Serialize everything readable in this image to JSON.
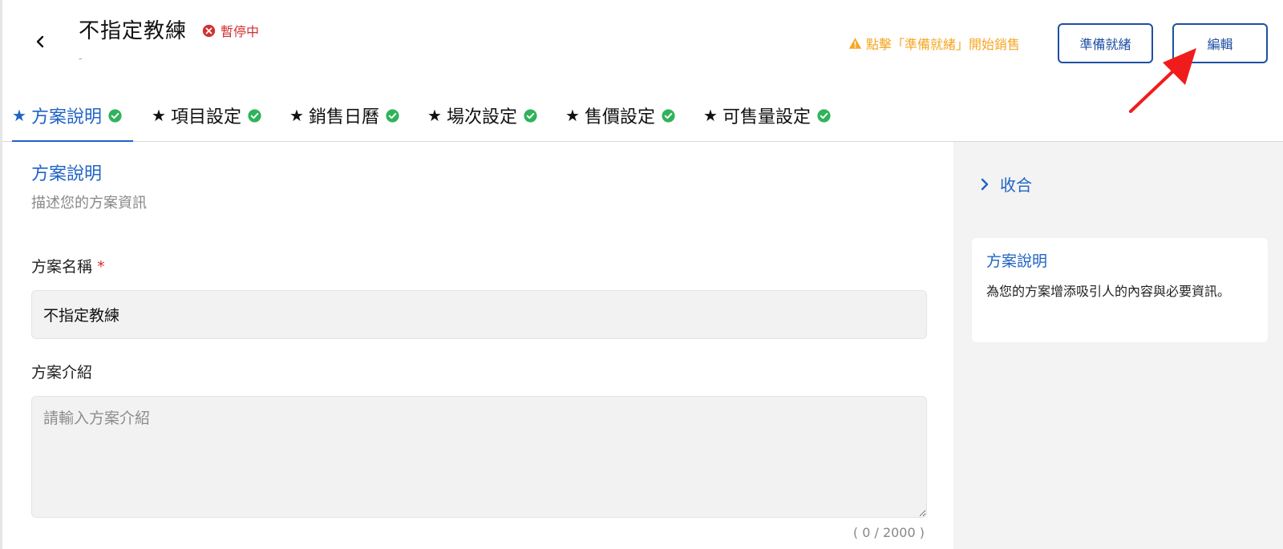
{
  "header": {
    "title": "不指定教練",
    "status": "暫停中",
    "subtitle": "-",
    "ready_hint": "點擊「準備就緒」開始銷售",
    "ready_button": "準備就緒",
    "edit_button": "編輯"
  },
  "tabs": [
    {
      "label": "方案說明",
      "active": true,
      "completed": true
    },
    {
      "label": "項目設定",
      "active": false,
      "completed": true
    },
    {
      "label": "銷售日曆",
      "active": false,
      "completed": true
    },
    {
      "label": "場次設定",
      "active": false,
      "completed": true
    },
    {
      "label": "售價設定",
      "active": false,
      "completed": true
    },
    {
      "label": "可售量設定",
      "active": false,
      "completed": true
    }
  ],
  "main": {
    "section_title": "方案說明",
    "section_desc": "描述您的方案資訊",
    "name_label": "方案名稱",
    "required_mark": "*",
    "name_value": "不指定教練",
    "intro_label": "方案介紹",
    "intro_placeholder": "請輸入方案介紹",
    "char_count": "( 0 / 2000 )"
  },
  "side": {
    "collapse_label": "收合",
    "card_title": "方案說明",
    "card_body": "為您的方案增添吸引人的內容與必要資訊。"
  },
  "colors": {
    "primary": "#1f63c5",
    "button_border": "#1f4fa3",
    "warning": "#f5a623",
    "error": "#d32f2f",
    "success": "#2fb35a",
    "annotation_arrow": "#f01c1c"
  },
  "icons": {
    "back": "chevron-left-icon",
    "status": "x-circle-icon",
    "hint": "warning-triangle-icon",
    "tab_star": "star-icon",
    "tab_done": "check-circle-icon",
    "collapse": "chevron-right-icon"
  }
}
